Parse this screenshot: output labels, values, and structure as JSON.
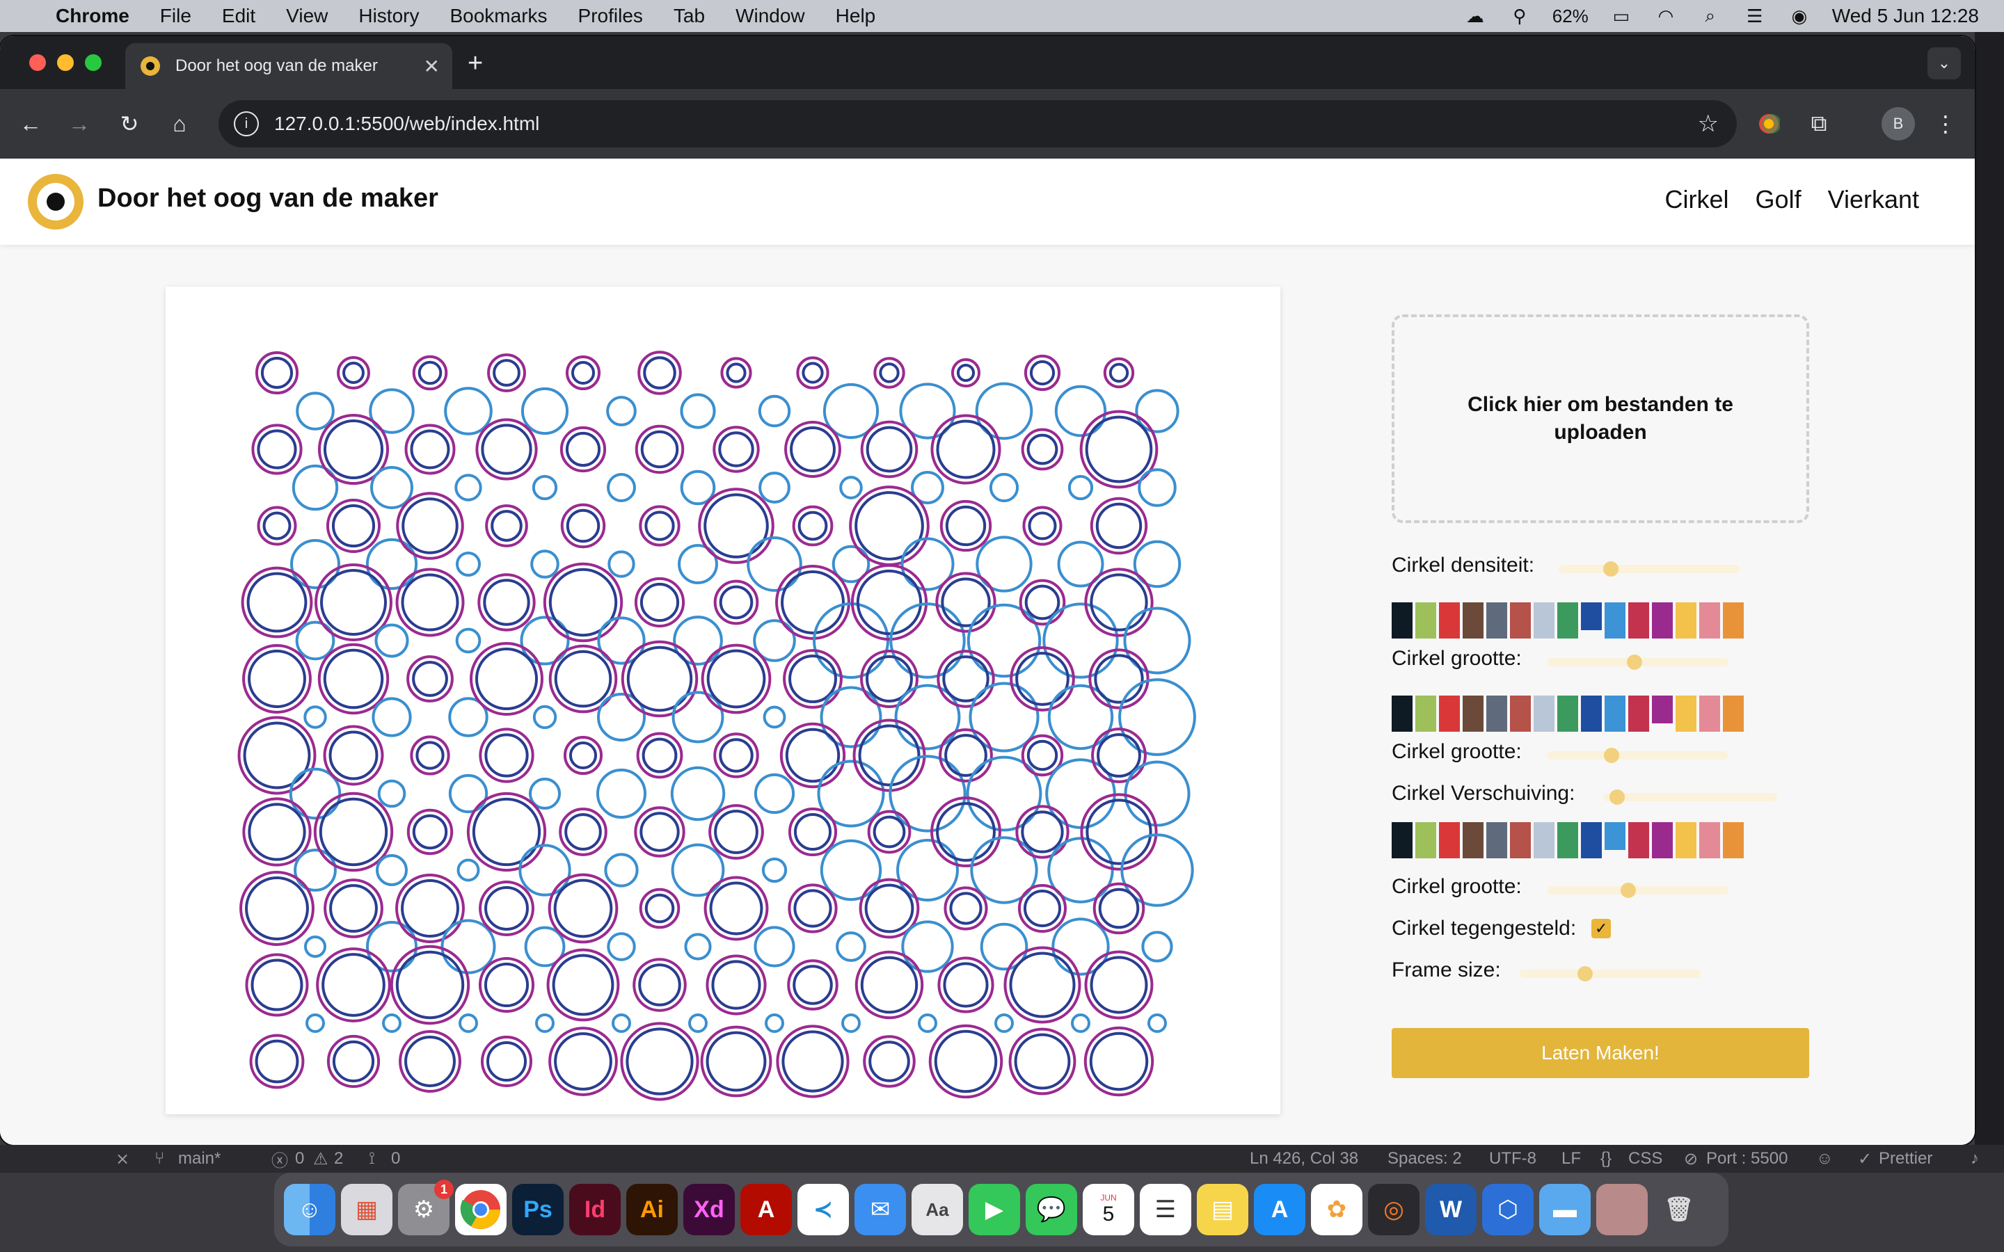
{
  "menubar": {
    "app": "Chrome",
    "items": [
      "File",
      "Edit",
      "View",
      "History",
      "Bookmarks",
      "Profiles",
      "Tab",
      "Window",
      "Help"
    ],
    "battery": "62%",
    "clock": "Wed 5 Jun  12:28"
  },
  "browser": {
    "tab_title": "Door het oog van de maker",
    "url": "127.0.0.1:5500/web/index.html",
    "profile_initial": "B"
  },
  "site": {
    "title": "Door het oog van de maker",
    "nav": [
      "Cirkel",
      "Golf",
      "Vierkant"
    ]
  },
  "panel": {
    "upload_text": "Click hier om bestanden te uploaden",
    "controls": [
      {
        "label": "Cirkel densiteit:",
        "value": 0.27
      },
      {
        "label": "Cirkel grootte:",
        "value": 0.48
      },
      {
        "label": "Cirkel grootte:",
        "value": 0.34
      },
      {
        "label": "Cirkel Verschuiving:",
        "value": 0.04
      },
      {
        "label": "Cirkel grootte:",
        "value": 0.44
      },
      {
        "label": "Frame size:",
        "value": 0.35
      }
    ],
    "checkbox_label": "Cirkel tegengesteld:",
    "checkbox_checked": true,
    "swatch_colors": [
      "#0e1a24",
      "#9dc05a",
      "#d93838",
      "#6b4a3a",
      "#5f6b7c",
      "#b5524a",
      "#b9c6d8",
      "#3c9a5f",
      "#1f4ea1",
      "#3c93d6",
      "#c3334e",
      "#9b2a8f",
      "#f2c24a",
      "#e38a96",
      "#e8933a"
    ],
    "button": "Laten Maken!"
  },
  "statusbar": {
    "branch": "main*",
    "problems": "0",
    "warnings": "2",
    "ports": "0",
    "position": "Ln 426, Col 38",
    "spaces": "Spaces: 2",
    "encoding": "UTF-8",
    "eol": "LF",
    "language": "CSS",
    "port": "Port : 5500",
    "formatter": "Prettier"
  },
  "dock": {
    "apps": [
      "Finder",
      "Launchpad",
      "System Settings",
      "Chrome",
      "Ps",
      "Id",
      "Ai",
      "Xd",
      "Acrobat",
      "VS Code",
      "Mail",
      "Font Book",
      "FaceTime",
      "Messages",
      "Calendar",
      "Reminders",
      "Notes",
      "App Store",
      "Photos",
      "Blender",
      "Word",
      "Cube",
      "Folder",
      "Photo",
      "Trash"
    ],
    "calendar_day": "5",
    "calendar_month": "JUN",
    "badge": "1"
  },
  "colors": {
    "accent": "#e9b53a",
    "circle_purple": "#9b2a8f",
    "circle_blue": "#3a8fcf",
    "circle_navy": "#2a3d8f"
  }
}
